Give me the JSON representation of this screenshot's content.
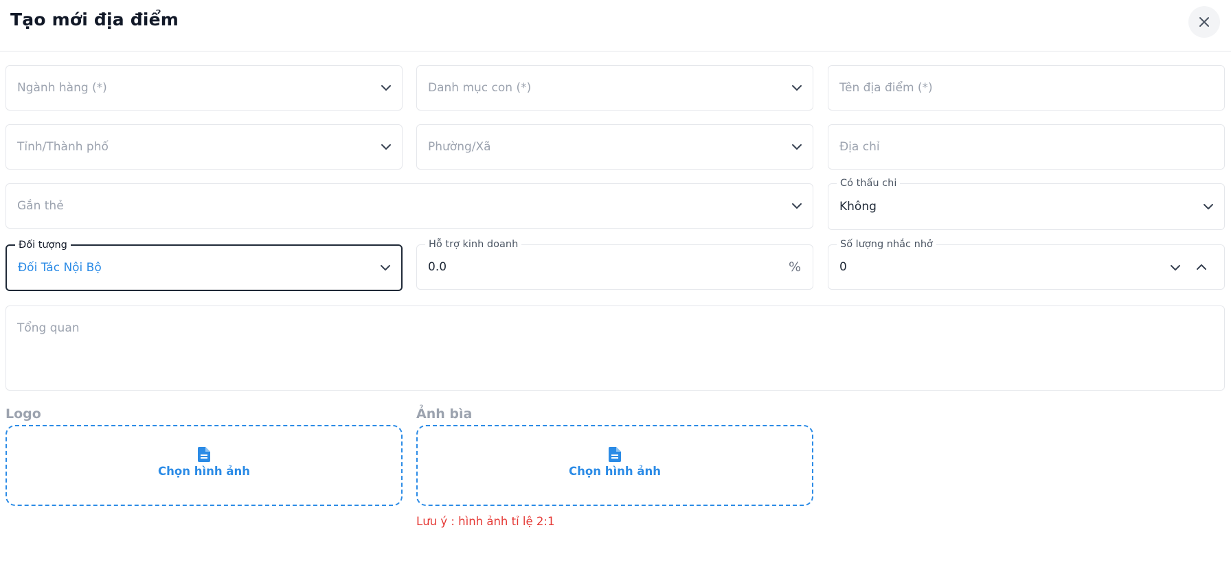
{
  "header": {
    "title": "Tạo mới địa điểm"
  },
  "fields": {
    "nganh_hang": {
      "placeholder": "Ngành hàng (*)"
    },
    "danh_muc_con": {
      "placeholder": "Danh mục con (*)"
    },
    "ten_dia_diem": {
      "placeholder": "Tên địa điểm (*)"
    },
    "tinh_thanh_pho": {
      "placeholder": "Tỉnh/Thành phố"
    },
    "phuong_xa": {
      "placeholder": "Phường/Xã"
    },
    "dia_chi": {
      "placeholder": "Địa chỉ"
    },
    "gan_the": {
      "placeholder": "Gắn thẻ"
    },
    "co_thau_chi": {
      "label": "Có thấu chi",
      "value": "Không"
    },
    "doi_tuong": {
      "label": "Đối tượng",
      "value": "Đối Tác Nội Bộ"
    },
    "ho_tro_kinh_doanh": {
      "label": "Hỗ trợ kinh doanh",
      "value": "0.0",
      "suffix": "%"
    },
    "so_luong_nhac_nho": {
      "label": "Số lượng nhắc nhở",
      "value": "0"
    },
    "tong_quan": {
      "placeholder": "Tổng quan"
    }
  },
  "uploads": {
    "logo": {
      "label": "Logo",
      "button": "Chọn hình ảnh"
    },
    "anh_bia": {
      "label": "Ảnh bìa",
      "button": "Chọn hình ảnh",
      "note": "Lưu ý : hình ảnh tỉ lệ 2:1"
    }
  },
  "colors": {
    "accent": "#2b8be6",
    "error": "#e53935",
    "focus_border": "#1f2937"
  },
  "icons": {
    "close": "close-icon",
    "dropdown": "chevron-down-icon",
    "stepper_up": "chevron-up-icon",
    "file": "file-icon"
  }
}
